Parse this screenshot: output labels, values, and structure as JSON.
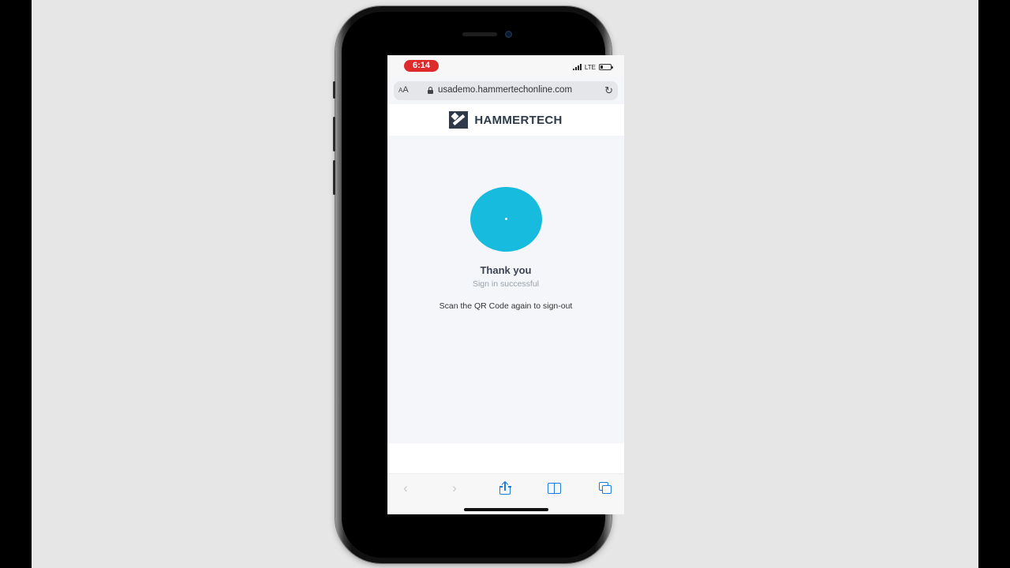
{
  "status_bar": {
    "time": "6:14",
    "network": "LTE"
  },
  "browser": {
    "text_size_label": "AA",
    "url": "usademo.hammertechonline.com",
    "reload_icon": "reload-icon"
  },
  "header": {
    "brand": "HAMMERTECH",
    "logo_icon": "hammertech-logo"
  },
  "message": {
    "title": "Thank you",
    "subtitle": "Sign in successful",
    "instruction": "Scan the QR Code again to sign-out"
  },
  "toolbar": {
    "back_icon": "chevron-left-icon",
    "forward_icon": "chevron-right-icon",
    "share_icon": "share-icon",
    "bookmarks_icon": "bookmarks-icon",
    "tabs_icon": "tabs-icon"
  },
  "colors": {
    "accent_circle": "#17bbdd",
    "time_pill": "#dd2b2b",
    "brand": "#2e3a4a",
    "toolbar_icons": "#1a7be0"
  }
}
